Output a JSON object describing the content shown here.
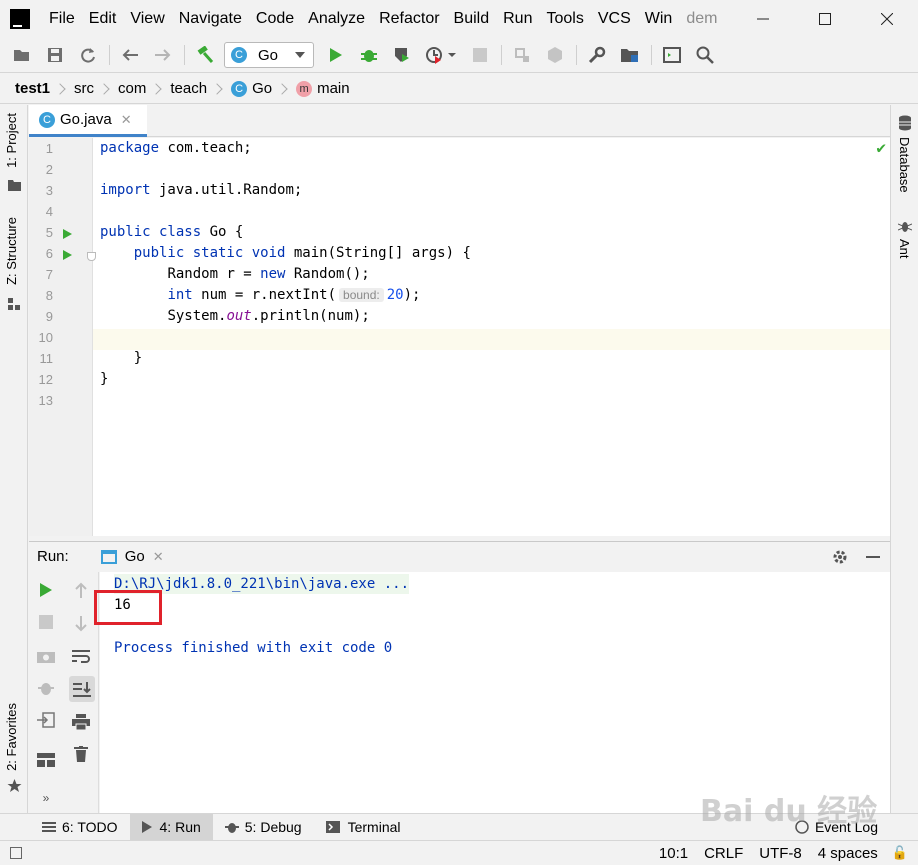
{
  "menu": {
    "items": [
      "File",
      "Edit",
      "View",
      "Navigate",
      "Code",
      "Analyze",
      "Refactor",
      "Build",
      "Run",
      "Tools",
      "VCS",
      "Win"
    ],
    "project_title": "dem"
  },
  "toolbar": {
    "run_config": "Go"
  },
  "breadcrumb": {
    "items": [
      "test1",
      "src",
      "com",
      "teach",
      "Go",
      "main"
    ]
  },
  "left_tools": {
    "project": "1: Project",
    "structure": "Z: Structure",
    "favorites": "2: Favorites"
  },
  "right_tools": {
    "database": "Database",
    "ant": "Ant"
  },
  "editor": {
    "tab": "Go.java",
    "line_numbers": [
      "1",
      "2",
      "3",
      "4",
      "5",
      "6",
      "7",
      "8",
      "9",
      "10",
      "11",
      "12",
      "13"
    ],
    "param_hint": "bound:",
    "code": {
      "l1_kw": "package",
      "l1_rest": " com.teach;",
      "l3_kw": "import",
      "l3_rest": " java.util.Random;",
      "l5_kw": "public class",
      "l5_rest": " Go {",
      "l6_indent": "    ",
      "l6_kw": "public static void",
      "l6_rest": " main(String[] args) {",
      "l7_indent": "        ",
      "l7_pre": "Random r = ",
      "l7_kw": "new",
      "l7_rest": " Random();",
      "l8_indent": "        ",
      "l8_kw": "int",
      "l8_pre": " num = r.nextInt(",
      "l8_num": "20",
      "l8_rest": ");",
      "l9_indent": "        ",
      "l9_pre": "System.",
      "l9_fld": "out",
      "l9_rest": ".println(num);",
      "l11": "    }",
      "l12": "}"
    }
  },
  "run_panel": {
    "title": "Run:",
    "tab": "Go",
    "console": {
      "command": "D:\\RJ\\jdk1.8.0_221\\bin\\java.exe ...",
      "output": "16",
      "exit": "Process finished with exit code 0"
    }
  },
  "bottom_tools": {
    "todo": "6: TODO",
    "run": "4: Run",
    "debug": "5: Debug",
    "terminal": "Terminal",
    "event_log": "Event Log"
  },
  "status": {
    "position": "10:1",
    "line_sep": "CRLF",
    "encoding": "UTF-8",
    "indent": "4 spaces"
  },
  "watermark": "Bai du 经验",
  "colors": {
    "keyword": "#0033b3",
    "number": "#1750eb",
    "field": "#871094",
    "run_green": "#3aaa35",
    "highlight_red": "#e0222b"
  }
}
